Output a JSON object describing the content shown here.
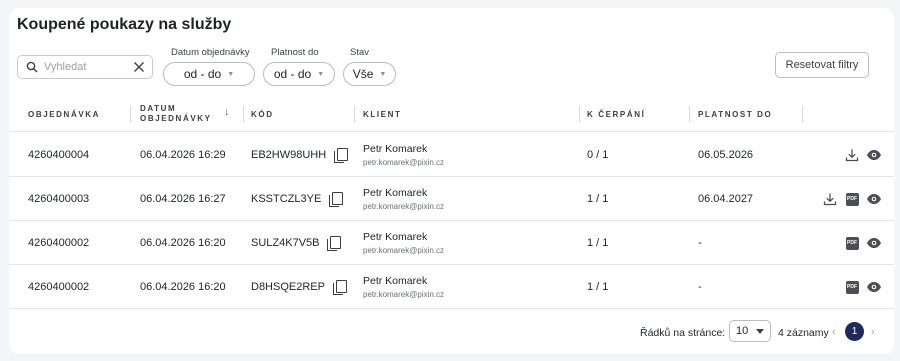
{
  "page": {
    "title": "Koupené poukazy na služby"
  },
  "filters": {
    "search_placeholder": "Vyhledat",
    "order_date_label": "Datum objednávky",
    "order_date_value": "od - do",
    "validity_label": "Platnost do",
    "validity_value": "od - do",
    "status_label": "Stav",
    "status_value": "Vše",
    "reset_label": "Resetovat filtry"
  },
  "table": {
    "headers": {
      "order": "OBJEDNÁVKA",
      "order_date_line1": "DATUM",
      "order_date_line2": "OBJEDNÁVKY",
      "code": "KÓD",
      "client": "KLIENT",
      "usage": "K ČERPÁNÍ",
      "valid_until": "PLATNOST DO"
    },
    "rows": [
      {
        "order": "4260400004",
        "date": "06.04.2026 16:29",
        "code": "EB2HW98UHH",
        "client_name": "Petr Komarek",
        "client_email": "petr.komarek@pixin.cz",
        "usage": "0 / 1",
        "valid_until": "06.05.2026",
        "actions": [
          "download",
          "view"
        ]
      },
      {
        "order": "4260400003",
        "date": "06.04.2026 16:27",
        "code": "KSSTCZL3YE",
        "client_name": "Petr Komarek",
        "client_email": "petr.komarek@pixin.cz",
        "usage": "1 / 1",
        "valid_until": "06.04.2027",
        "actions": [
          "download",
          "pdf",
          "view"
        ]
      },
      {
        "order": "4260400002",
        "date": "06.04.2026 16:20",
        "code": "SULZ4K7V5B",
        "client_name": "Petr Komarek",
        "client_email": "petr.komarek@pixin.cz",
        "usage": "1 / 1",
        "valid_until": "-",
        "actions": [
          "pdf",
          "view"
        ]
      },
      {
        "order": "4260400002",
        "date": "06.04.2026 16:20",
        "code": "D8HSQE2REP",
        "client_name": "Petr Komarek",
        "client_email": "petr.komarek@pixin.cz",
        "usage": "1 / 1",
        "valid_until": "-",
        "actions": [
          "pdf",
          "view"
        ]
      }
    ]
  },
  "pagination": {
    "rows_per_page_label": "Řádků na stránce:",
    "rows_per_page_value": "10",
    "count_label": "4 záznamy",
    "current_page": "1"
  },
  "icons": {
    "search": "search-icon",
    "clear": "close-icon",
    "sort": "arrow-down-icon",
    "copy": "copy-icon",
    "download": "download-icon",
    "pdf": "pdf-icon",
    "view": "eye-icon"
  },
  "colors": {
    "accent": "#1e2a5a"
  }
}
